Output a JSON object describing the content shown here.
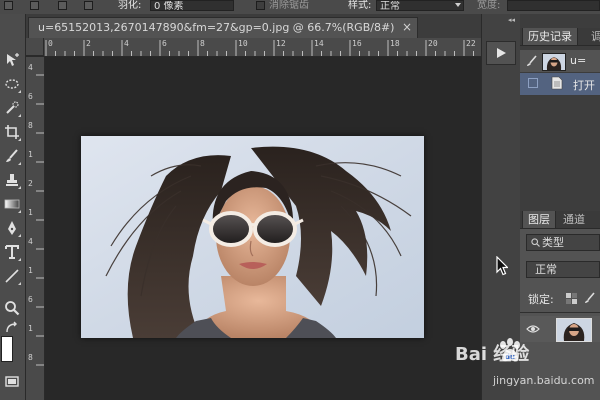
{
  "options_bar": {
    "feather_label": "羽化:",
    "feather_value": "0 像素",
    "antialias_label": "消除锯齿",
    "style_label": "样式:",
    "style_value": "正常",
    "width_label": "宽度:"
  },
  "document": {
    "tab_title": "u=65152013,2670147890&fm=27&gp=0.jpg @ 66.7%(RGB/8#)",
    "close_glyph": "×",
    "ruler_top_labels": [
      "0",
      "2",
      "4",
      "6",
      "8",
      "10",
      "12",
      "14",
      "16",
      "18",
      "20",
      "22"
    ],
    "ruler_left_labels": [
      "4",
      "6",
      "8",
      "1",
      "2",
      "1",
      "4",
      "1",
      "6",
      "1",
      "8"
    ]
  },
  "history_panel": {
    "tabs": [
      "历史记录",
      "调"
    ],
    "snapshot_label": "u=",
    "items": [
      "打开"
    ]
  },
  "layers_panel": {
    "tabs": [
      "图层",
      "通道"
    ],
    "filter_kind": "类型",
    "blend_mode": "正常",
    "lock_label": "锁定:"
  },
  "tools": [
    "move-tool",
    "marquee-tool",
    "lasso-tool",
    "quick-select-tool",
    "crop-tool",
    "eyedropper-tool",
    "brush-tool",
    "clone-stamp-tool",
    "eraser-tool",
    "gradient-tool",
    "pen-tool",
    "type-tool",
    "path-select-tool",
    "shape-tool",
    "zoom-tool",
    "hand-tool"
  ],
  "watermark": {
    "brand": "Bai 经验",
    "url": "jingyan.baidu.com"
  },
  "colors": {
    "panel_bg": "#535353",
    "canvas_bg": "#282828",
    "selection": "#536380",
    "accent": "#2b5fbf"
  }
}
